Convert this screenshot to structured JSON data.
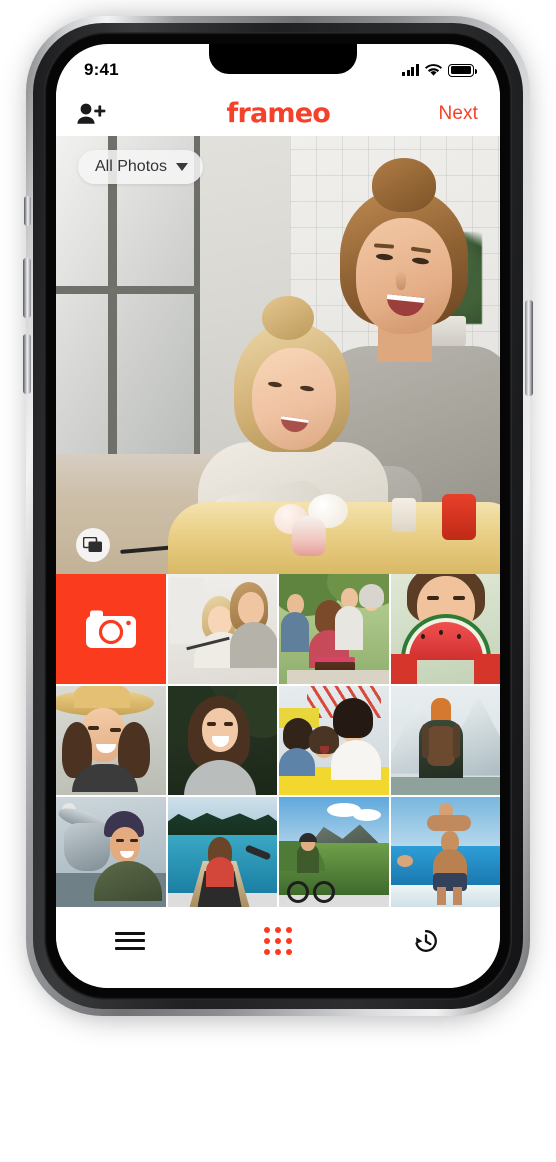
{
  "device": {
    "kind": "smartphone-mockup",
    "frame_color": "#c9cbcd"
  },
  "status_bar": {
    "time": "9:41",
    "cellular_icon": "signal-bars-icon",
    "wifi_icon": "wifi-icon",
    "battery_icon": "battery-full-icon"
  },
  "header": {
    "add_person_icon": "person-add-icon",
    "brand": "frameo",
    "next_label": "Next"
  },
  "hero": {
    "album_filter_label": "All Photos",
    "album_filter_caret": "chevron-down-icon",
    "multi_select_icon": "multi-photo-stack-icon",
    "alt": "Woman and young girl laughing together at a kitchen counter"
  },
  "grid": {
    "camera_tile": {
      "icon": "camera-icon",
      "background": "#FA3B1E",
      "label": "Take photo"
    },
    "thumbnails": [
      {
        "id": "thumb-1",
        "alt": "Girl and woman baking in kitchen"
      },
      {
        "id": "thumb-2",
        "alt": "Family celebrating birthday with cake outdoors"
      },
      {
        "id": "thumb-3",
        "alt": "Woman holding slice of watermelon over face"
      },
      {
        "id": "thumb-4",
        "alt": "Smiling woman wearing straw hat"
      },
      {
        "id": "thumb-5",
        "alt": "Laughing woman in front of evergreen tree"
      },
      {
        "id": "thumb-6",
        "alt": "Mother and daughters on amusement park ride"
      },
      {
        "id": "thumb-7",
        "alt": "Hiker with backpack facing snowy mountain"
      },
      {
        "id": "thumb-8",
        "alt": "Man holding up a freshly caught fish"
      },
      {
        "id": "thumb-9",
        "alt": "Woman paddling a canoe on a lake"
      },
      {
        "id": "thumb-10",
        "alt": "Mountain biker on green alpine meadow"
      },
      {
        "id": "thumb-11",
        "alt": "Man carrying child on shoulders at the beach"
      }
    ]
  },
  "bottom_nav": {
    "items": [
      {
        "id": "nav-menu",
        "icon": "hamburger-menu-icon",
        "active": false
      },
      {
        "id": "nav-gallery",
        "icon": "grid-dots-icon",
        "active": true
      },
      {
        "id": "nav-history",
        "icon": "history-clock-icon",
        "active": false
      }
    ]
  },
  "colors": {
    "brand_red": "#F6412A",
    "camera_tile_red": "#FA3B1E",
    "accent_active": "#FA3B1E",
    "screen_background": "#FFFFFF",
    "text_primary": "#111111"
  }
}
